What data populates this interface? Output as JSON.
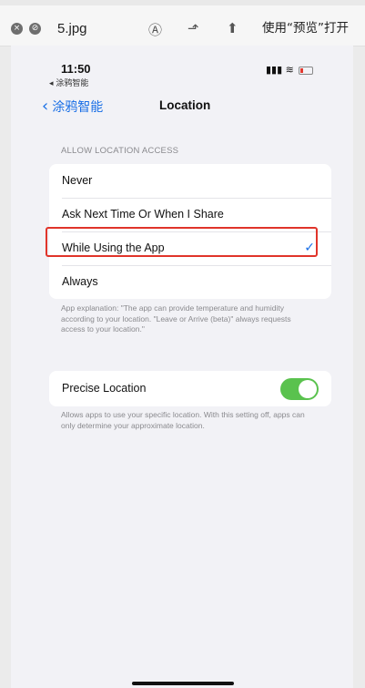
{
  "viewer": {
    "filename": "5.jpg",
    "open_label": "使用“预览”打开",
    "close_icon_glyph": "×",
    "fullscreen_icon_glyph": "⊘",
    "markup_icon_glyph": "Ⓐ",
    "rotate_icon_glyph": "⬏",
    "share_icon_glyph": "⬆"
  },
  "phone": {
    "status": {
      "time": "11:50",
      "back_app": "◂ 涂鸦智能",
      "signal": "▮▮▮",
      "wifi": "≋"
    },
    "nav": {
      "back_label": "涂鸦智能",
      "back_chevron": "‹",
      "title": "Location"
    },
    "access": {
      "header": "ALLOW LOCATION ACCESS",
      "options": [
        {
          "label": "Never",
          "selected": false
        },
        {
          "label": "Ask Next Time Or When I Share",
          "selected": false
        },
        {
          "label": "While Using the App",
          "selected": true
        },
        {
          "label": "Always",
          "selected": false
        }
      ],
      "check_glyph": "✓",
      "explanation": "App explanation: \"The app can provide temperature and humidity according to your location. \"Leave or Arrive (beta)\" always requests access to your location.\""
    },
    "precise": {
      "label": "Precise Location",
      "enabled": true,
      "footnote": "Allows apps to use your specific location. With this setting off, apps can only determine your approximate location."
    },
    "colors": {
      "accent": "#1a6fe6",
      "toggle_on": "#5ac24e",
      "highlight": "#e0342a"
    }
  }
}
